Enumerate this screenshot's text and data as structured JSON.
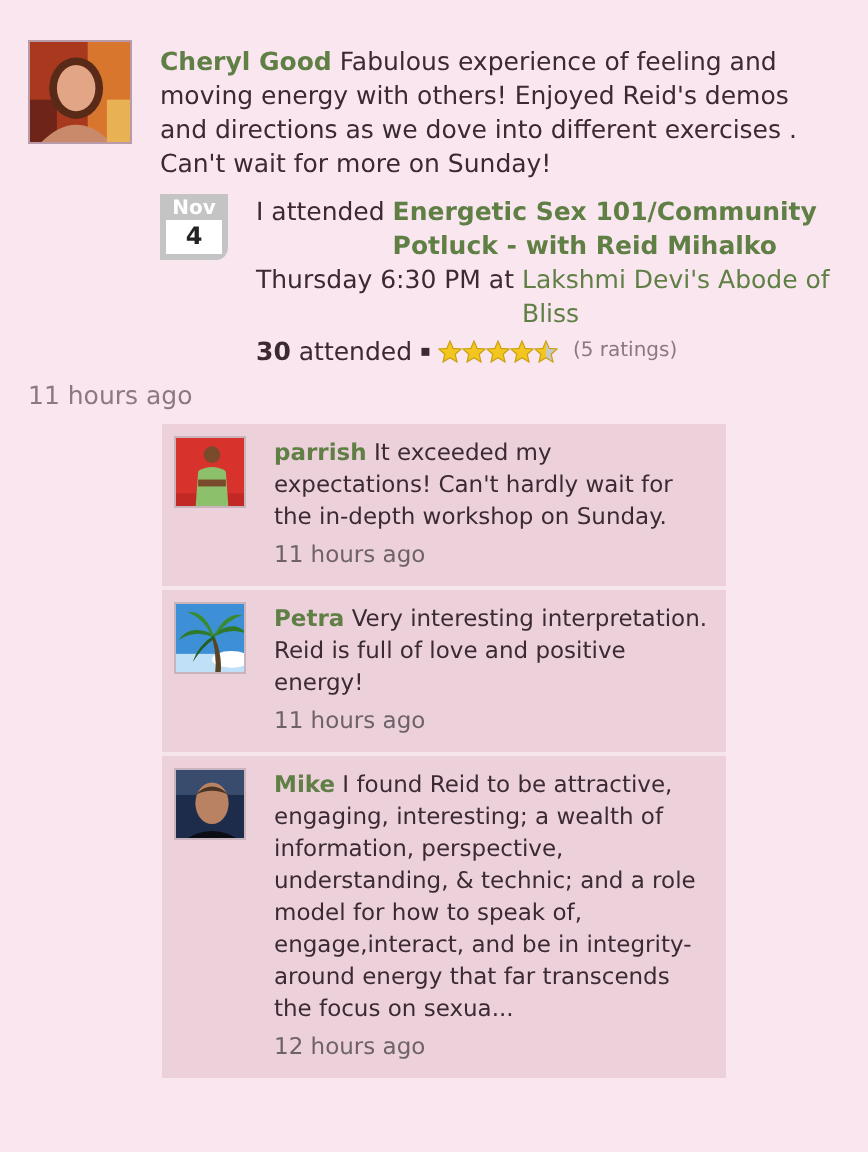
{
  "post": {
    "author": "Cheryl Good",
    "text": "Fabulous experience of feeling and moving energy with others! Enjoyed Reid's demos and directions as we dove into different exercises . Can't wait for more on Sunday!",
    "event": {
      "month": "Nov",
      "day": "4",
      "prefix": "I attended",
      "title": "Energetic Sex 101/Community Potluck - with Reid Mihalko",
      "time": "Thursday 6:30 PM at",
      "venue": "Lakshmi Devi's Abode of Bliss",
      "attended_count": "30",
      "attended_label": "attended",
      "separator": "▪",
      "stars": 4.5,
      "ratings": "(5 ratings)"
    },
    "time": "11 hours ago"
  },
  "comments": [
    {
      "author": "parrish",
      "text": "It exceeded my expectations! Can't hardly wait for the in-depth workshop on Sunday.",
      "time": "11 hours ago"
    },
    {
      "author": "Petra",
      "text": "Very interesting interpretation. Reid is full of love and positive energy!",
      "time": "11 hours ago"
    },
    {
      "author": "Mike",
      "text": "I found Reid to be attractive, engaging, interesting; a wealth of information, perspective, understanding, & technic; and a role model for how to speak of, engage,interact, and be in integrity-around energy that far transcends the focus on sexua...",
      "time": "12 hours ago"
    }
  ]
}
